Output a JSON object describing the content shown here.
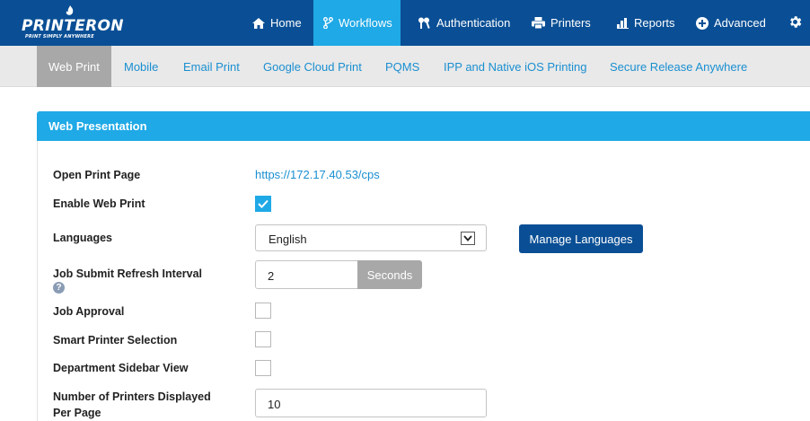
{
  "brand": {
    "name": "PRINTERON",
    "tagline": "PRINT SIMPLY ANYWHERE"
  },
  "nav": {
    "home": "Home",
    "workflows": "Workflows",
    "authentication": "Authentication",
    "printers": "Printers",
    "reports": "Reports",
    "advanced": "Advanced",
    "active": "Workflows"
  },
  "subnav": {
    "web_print": "Web Print",
    "mobile": "Mobile",
    "email_print": "Email Print",
    "google_cloud_print": "Google Cloud Print",
    "pqms": "PQMS",
    "ipp": "IPP and Native iOS Printing",
    "secure_release": "Secure Release Anywhere",
    "active": "Web Print"
  },
  "panel": {
    "title": "Web Presentation",
    "open_print_page": {
      "label": "Open Print Page",
      "value": "https://172.17.40.53/cps"
    },
    "enable_web_print": {
      "label": "Enable Web Print",
      "checked": true
    },
    "languages": {
      "label": "Languages",
      "selected": "English",
      "button": "Manage Languages"
    },
    "job_submit_refresh": {
      "label": "Job Submit Refresh Interval",
      "value": "2",
      "unit": "Seconds",
      "help_icon": "help-icon"
    },
    "job_approval": {
      "label": "Job Approval",
      "checked": false
    },
    "smart_printer_selection": {
      "label": "Smart Printer Selection",
      "checked": false
    },
    "department_sidebar_view": {
      "label": "Department Sidebar View",
      "checked": false
    },
    "printers_per_page": {
      "label_line1": "Number of Printers Displayed",
      "label_line2": "Per Page",
      "value": "10"
    }
  },
  "colors": {
    "nav_bg": "#0a4f95",
    "accent": "#1fa9e6",
    "subnav_bg": "#e9e9e9",
    "link": "#1a8fd1"
  }
}
